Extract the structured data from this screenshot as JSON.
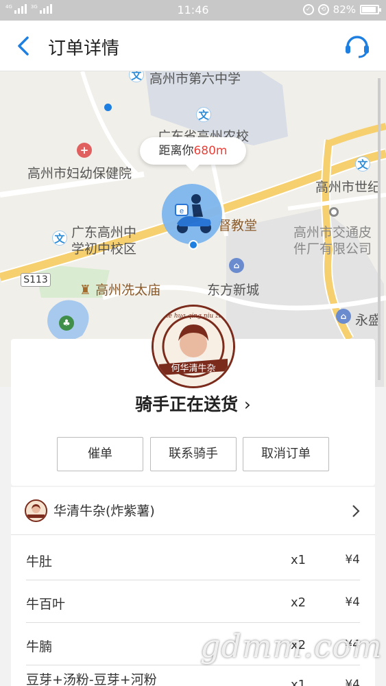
{
  "status_bar": {
    "net1": "4G",
    "net2": "3G",
    "time": "11:46",
    "battery": "82%",
    "battery_level": 0.82
  },
  "header": {
    "title": "订单详情",
    "back_icon": "chevron-left-icon",
    "service_icon": "headset-icon",
    "accent": "#1e7fe0"
  },
  "map": {
    "labels": {
      "school6": "高州市第六中学",
      "agri": "广东省高州农校",
      "hospital": "高州市妇幼保健院",
      "shiji": "高州市世纪",
      "middle1": "广东高州中",
      "middle2": "学初中校区",
      "church": "督教堂",
      "transport1": "高州市交通皮",
      "transport2": "件厂有限公司",
      "road": "S113",
      "temple": "高州冼太庙",
      "dongfang": "东方新城",
      "yongsheng": "永盛"
    },
    "distance_prefix": "距离你",
    "distance_value": "680m",
    "distance_color": "#e9423a"
  },
  "delivery": {
    "brand_text": "he hua qing niu za",
    "brand_cn": "何华清牛杂",
    "status": "骑手正在送货",
    "buttons": [
      "催单",
      "联系骑手",
      "取消订单"
    ]
  },
  "store": {
    "name": "华清牛杂(炸紫薯)"
  },
  "items": [
    {
      "name": "牛肚",
      "qty": "x1",
      "price": "¥4"
    },
    {
      "name": "牛百叶",
      "qty": "x2",
      "price": "¥4"
    },
    {
      "name": "牛腩",
      "qty": "x2",
      "price": "¥4"
    },
    {
      "name": "豆芽+汤粉-豆芽+河粉",
      "qty": "x1",
      "price": "¥4"
    }
  ],
  "watermark": "gdmm.com"
}
